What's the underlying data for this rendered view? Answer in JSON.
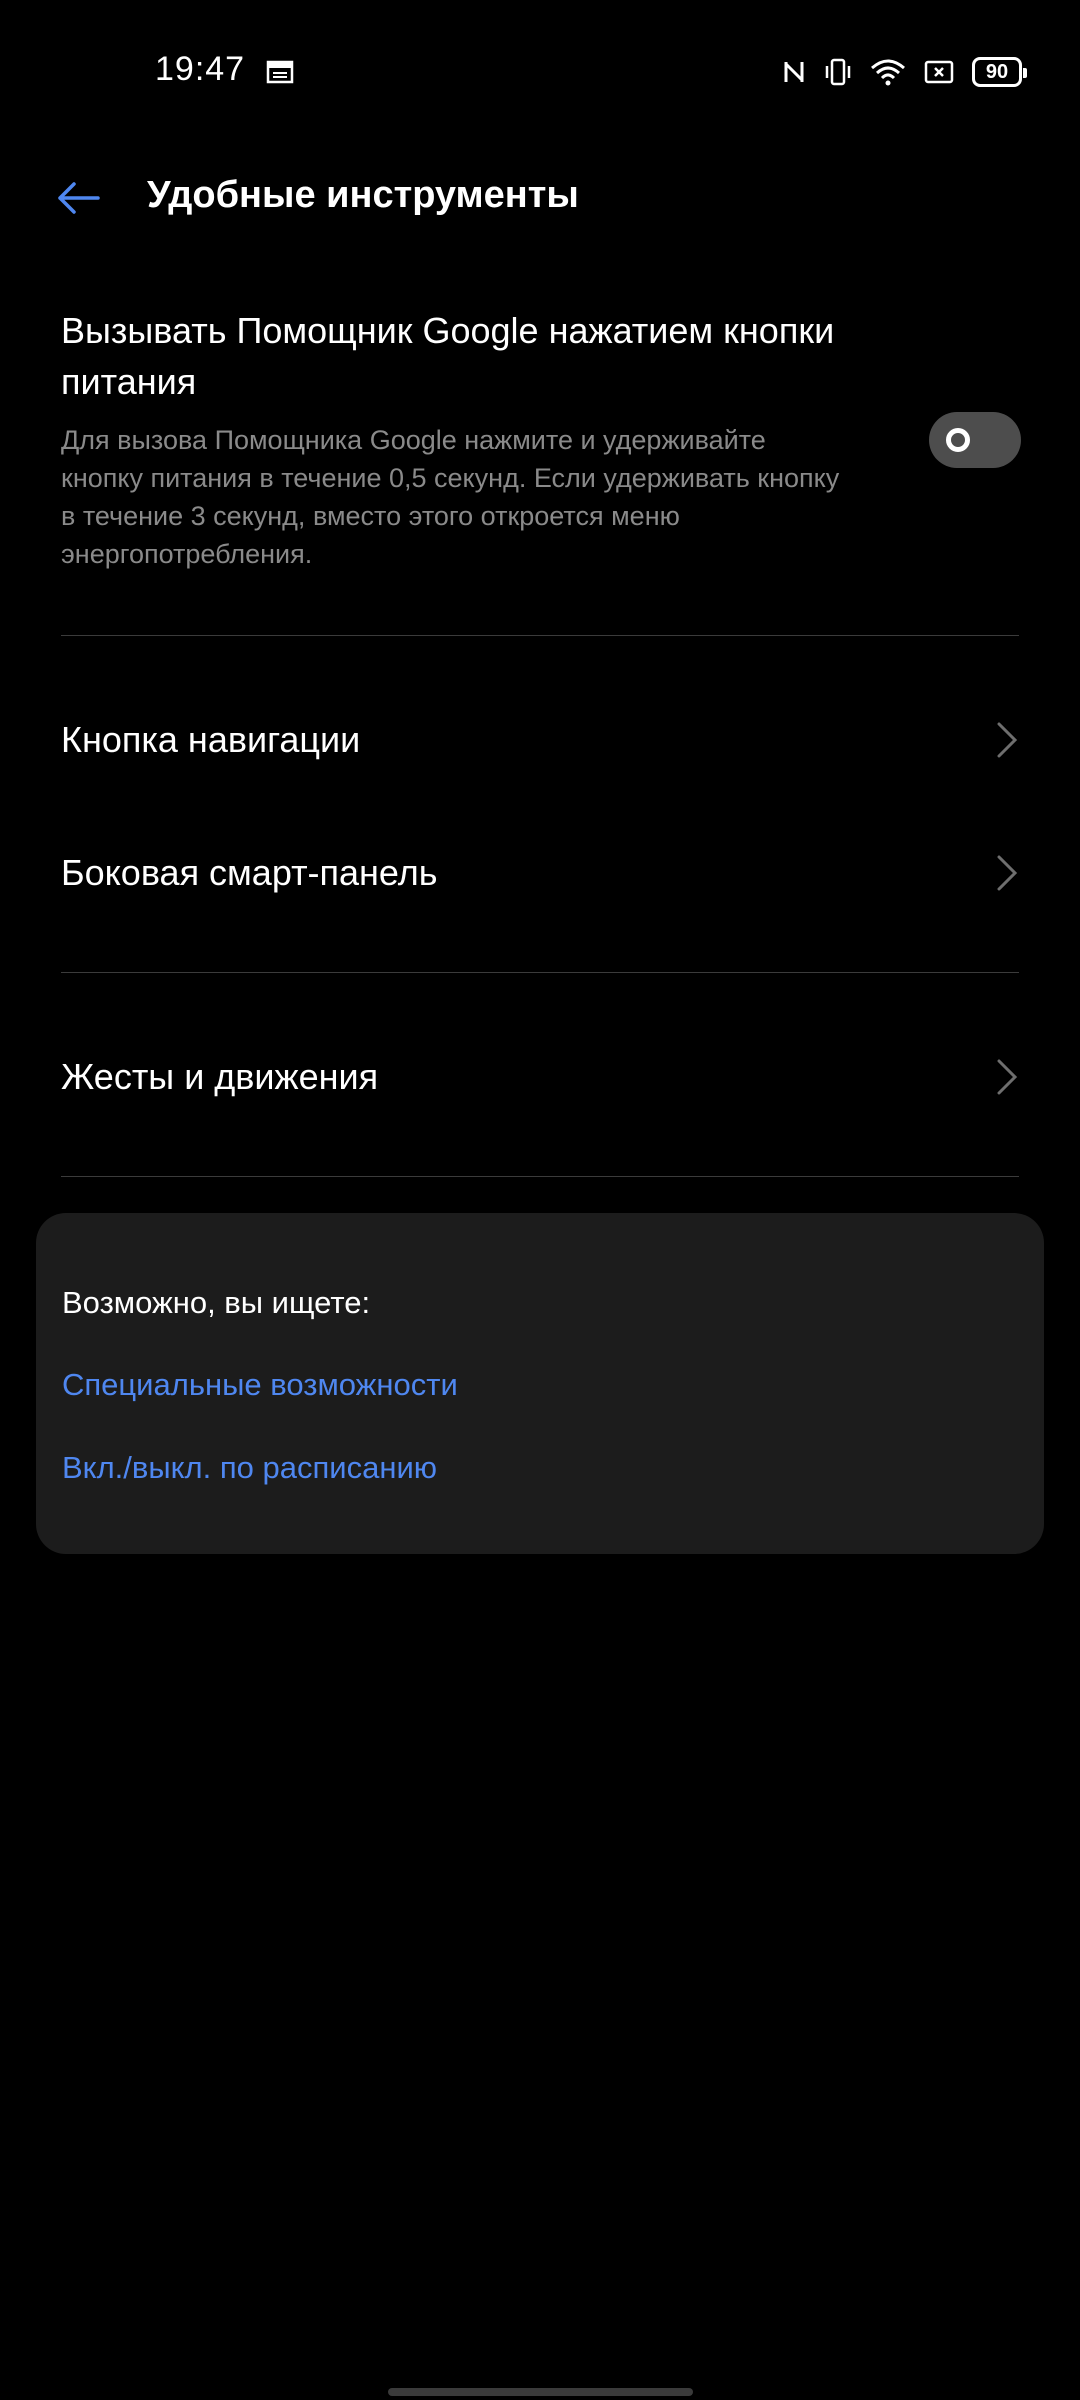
{
  "status_bar": {
    "time": "19:47",
    "battery_level": "90",
    "icons": [
      "calendar-icon",
      "nfc-icon",
      "vibrate-icon",
      "wifi-icon",
      "no-sim-icon",
      "battery-icon"
    ]
  },
  "header": {
    "title": "Удобные инструменты",
    "back_icon": "arrow-left-icon"
  },
  "assistant_setting": {
    "title": "Вызывать Помощник Google нажатием кнопки питания",
    "description": "Для вызова Помощника Google нажмите и удерживайте кнопку питания в течение 0,5 секунд. Если удерживать кнопку в течение 3 секунд, вместо этого откроется меню энергопотребления.",
    "toggle_on": false
  },
  "nav_items": [
    {
      "label": "Кнопка навигации"
    },
    {
      "label": "Боковая смарт-панель"
    },
    {
      "label": "Жесты и движения"
    }
  ],
  "suggestions": {
    "heading": "Возможно, вы ищете:",
    "links": [
      {
        "label": "Специальные возможности"
      },
      {
        "label": "Вкл./выкл. по расписанию"
      }
    ]
  },
  "colors": {
    "background": "#000000",
    "accent": "#4f87f0",
    "card": "#1c1c1c",
    "secondary_text": "#8a8a8a",
    "toggle_off": "#4d4d4d"
  }
}
